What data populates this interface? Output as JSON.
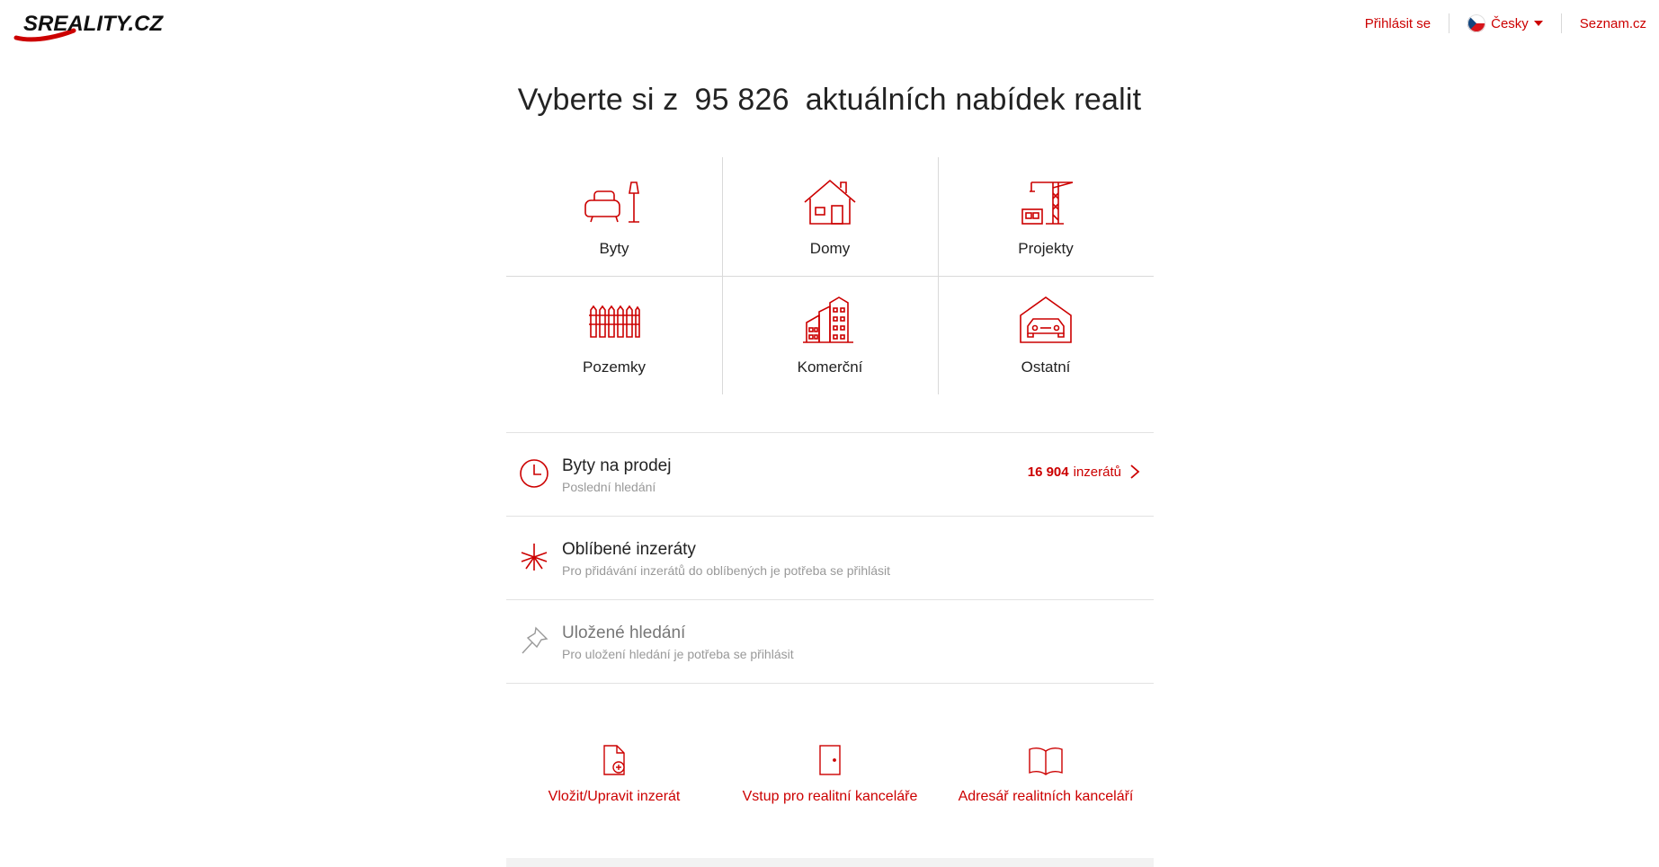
{
  "header": {
    "logo_text": "SREALITY.CZ",
    "login_label": "Přihlásit se",
    "language_label": "Česky",
    "seznam_label": "Seznam.cz"
  },
  "hero": {
    "prefix": "Vyberte si z",
    "count": "95 826",
    "suffix": "aktuálních nabídek realit"
  },
  "categories": [
    {
      "label": "Byty",
      "icon": "apartment-icon"
    },
    {
      "label": "Domy",
      "icon": "house-icon"
    },
    {
      "label": "Projekty",
      "icon": "construction-crane-icon"
    },
    {
      "label": "Pozemky",
      "icon": "fence-icon"
    },
    {
      "label": "Komerční",
      "icon": "commercial-buildings-icon"
    },
    {
      "label": "Ostatní",
      "icon": "garage-car-icon"
    }
  ],
  "rows": [
    {
      "title": "Byty na prodej",
      "subtitle": "Poslední hledání",
      "count": "16 904",
      "count_suffix": "inzerátů",
      "icon": "clock-icon"
    },
    {
      "title": "Oblíbené inzeráty",
      "subtitle": "Pro přidávání inzerátů do oblíbených je potřeba se přihlásit",
      "icon": "asterisk-star-icon"
    },
    {
      "title": "Uložené hledání",
      "subtitle": "Pro uložení hledání je potřeba se přihlásit",
      "icon": "pin-icon"
    }
  ],
  "bottom_links": [
    {
      "label": "Vložit/Upravit inzerát",
      "icon": "add-document-icon"
    },
    {
      "label": "Vstup pro realitní kanceláře",
      "icon": "door-icon"
    },
    {
      "label": "Adresář realitních kanceláří",
      "icon": "open-book-icon"
    }
  ],
  "colors": {
    "accent": "#cc0000",
    "text": "#222222",
    "muted": "#999999",
    "divider": "#d9d9d9"
  }
}
